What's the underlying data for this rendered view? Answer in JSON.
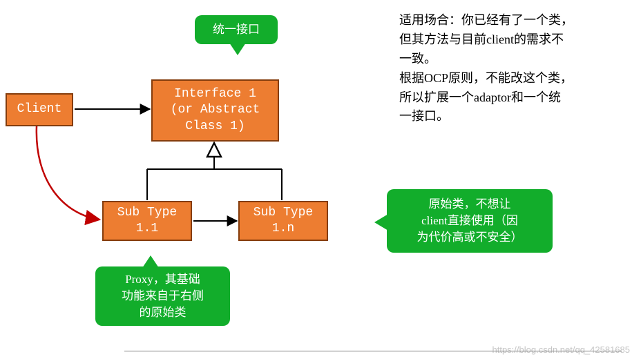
{
  "nodes": {
    "client": "Client",
    "interface": "Interface 1\n(or Abstract\nClass 1)",
    "sub1": "Sub Type\n1.1",
    "subn": "Sub Type\n1.n"
  },
  "callouts": {
    "top": "统一接口",
    "proxy": "Proxy，其基础\n功能来自于右侧\n的原始类",
    "original": "原始类，不想让\nclient直接使用（因\n为代价高或不安全）"
  },
  "description": "适用场合：你已经有了一个类，\n但其方法与目前client的需求不\n一致。\n根据OCP原则，不能改这个类，\n所以扩展一个adaptor和一个统\n一接口。",
  "watermark": "https://blog.csdn.net/qq_42581685",
  "colors": {
    "orange_fill": "#ed7d31",
    "orange_border": "#843c0c",
    "green": "#12ad2b"
  }
}
